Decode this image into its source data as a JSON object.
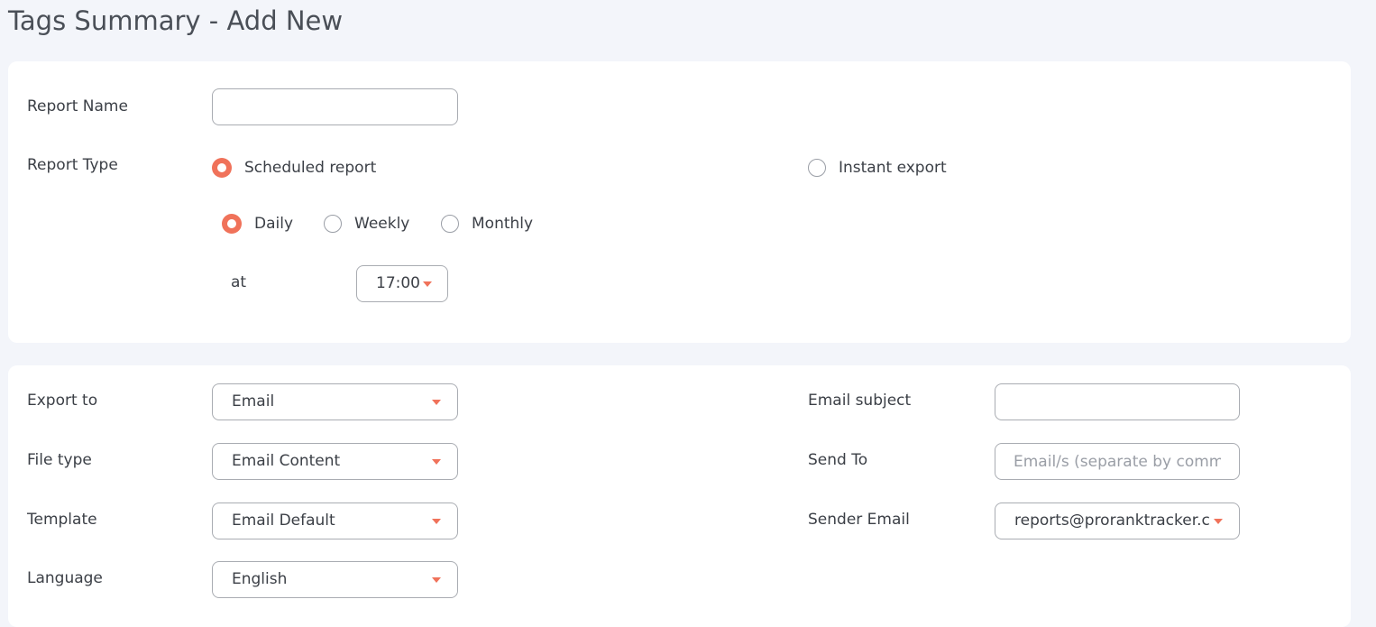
{
  "page": {
    "title": "Tags Summary - Add New"
  },
  "report": {
    "name_label": "Report Name",
    "name_value": "",
    "type_label": "Report Type",
    "type_options": {
      "scheduled": "Scheduled report",
      "instant": "Instant export"
    },
    "type_selected": "Scheduled report",
    "frequency_options": {
      "daily": "Daily",
      "weekly": "Weekly",
      "monthly": "Monthly"
    },
    "frequency_selected": "Daily",
    "at_label": "at",
    "time_value": "17:00"
  },
  "export": {
    "export_to_label": "Export to",
    "export_to_value": "Email",
    "file_type_label": "File type",
    "file_type_value": "Email Content",
    "template_label": "Template",
    "template_value": "Email Default",
    "language_label": "Language",
    "language_value": "English",
    "email_subject_label": "Email subject",
    "email_subject_value": "",
    "send_to_label": "Send To",
    "send_to_placeholder": "Email/s (separate by commas)",
    "sender_email_label": "Sender Email",
    "sender_email_value": "reports@proranktracker.com"
  },
  "colors": {
    "accent": "#f0725a",
    "background": "#f3f5fa",
    "card": "#ffffff",
    "border": "#a9acb2"
  }
}
